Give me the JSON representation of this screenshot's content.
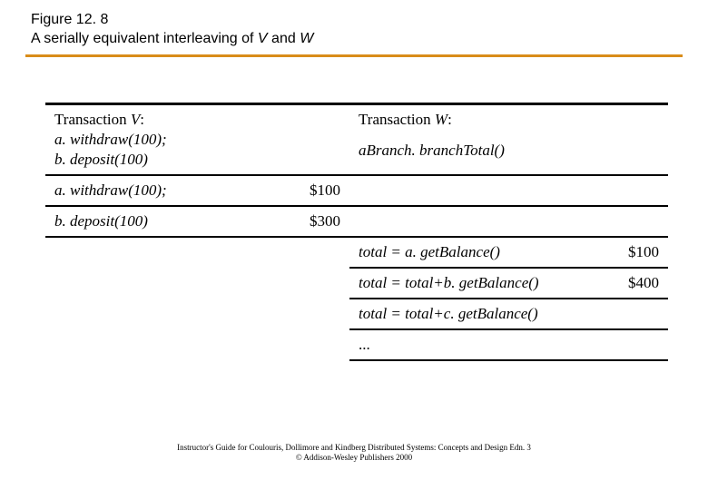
{
  "figure": {
    "label": "Figure 12. 8",
    "caption_prefix": "A serially equivalent interleaving of ",
    "caption_var1": "V",
    "caption_join": " and ",
    "caption_var2": "W"
  },
  "header": {
    "v_title": "Transaction V:",
    "v_line1": "a. withdraw(100);",
    "v_line2": "b. deposit(100)",
    "w_title": "Transaction W:",
    "w_line1": "aBranch. branchTotal()"
  },
  "rows": [
    {
      "v_op": "a. withdraw(100);",
      "v_amt": "$100",
      "w_op": "",
      "w_amt": ""
    },
    {
      "v_op": "b. deposit(100)",
      "v_amt": "$300",
      "w_op": "",
      "w_amt": ""
    },
    {
      "v_op": "",
      "v_amt": "",
      "w_op": "total = a. getBalance()",
      "w_amt": "$100"
    },
    {
      "v_op": "",
      "v_amt": "",
      "w_op": "total = total+b. getBalance()",
      "w_amt": "$400"
    },
    {
      "v_op": "",
      "v_amt": "",
      "w_op": "total = total+c. getBalance()",
      "w_amt": ""
    },
    {
      "v_op": "",
      "v_amt": "",
      "w_op": "...",
      "w_amt": ""
    }
  ],
  "footer": {
    "line1": "Instructor's Guide for Coulouris, Dollimore and Kindberg   Distributed Systems: Concepts and Design   Edn. 3",
    "line2": "©  Addison-Wesley Publishers 2000"
  }
}
